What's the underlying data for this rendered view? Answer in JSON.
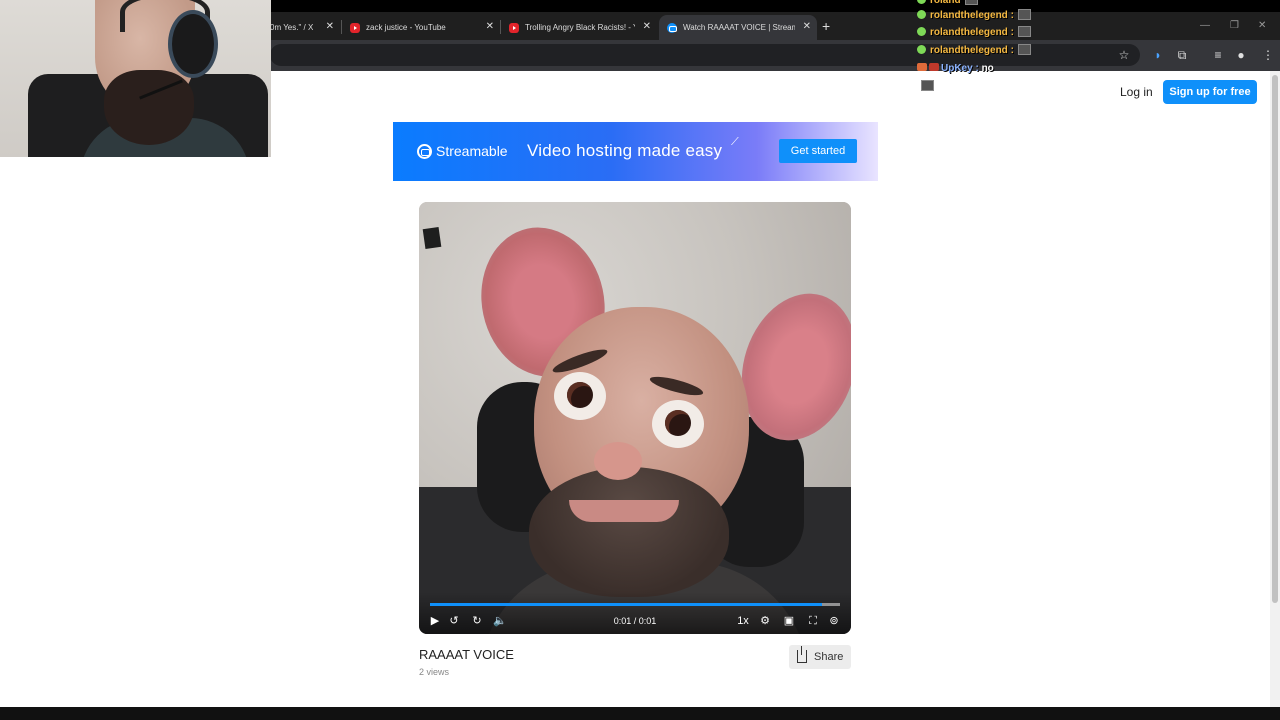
{
  "browser": {
    "tabs": [
      {
        "title": "0m Yes.\" / X",
        "favicon": "x-icon",
        "active": false
      },
      {
        "title": "zack justice - YouTube",
        "favicon": "youtube-icon",
        "active": false
      },
      {
        "title": "Trolling Angry Black Racists! - Y",
        "favicon": "youtube-icon",
        "active": false
      },
      {
        "title": "Watch RAAAAT VOICE | Stream",
        "favicon": "streamable-icon",
        "active": true
      }
    ],
    "new_tab_label": "+",
    "close_glyph": "✕"
  },
  "header": {
    "login_label": "Log in",
    "signup_label": "Sign up for free"
  },
  "banner": {
    "brand": "Streamable",
    "tagline": "Video hosting made easy",
    "cta_label": "Get started",
    "accent": "#0f90fa"
  },
  "player": {
    "time_display": "0:01 / 0:01",
    "speed_label": "1x",
    "progress_fraction": 0.955
  },
  "video": {
    "title": "RAAAAT VOICE",
    "views": "2 views",
    "share_label": "Share"
  },
  "chat": [
    {
      "user": "roland",
      "message": "",
      "partial": true
    },
    {
      "user": "rolandthelegend",
      "message": ""
    },
    {
      "user": "rolandthelegend",
      "message": ""
    },
    {
      "user": "rolandthelegend",
      "message": ""
    },
    {
      "user": "UpKey",
      "message": "no"
    }
  ]
}
